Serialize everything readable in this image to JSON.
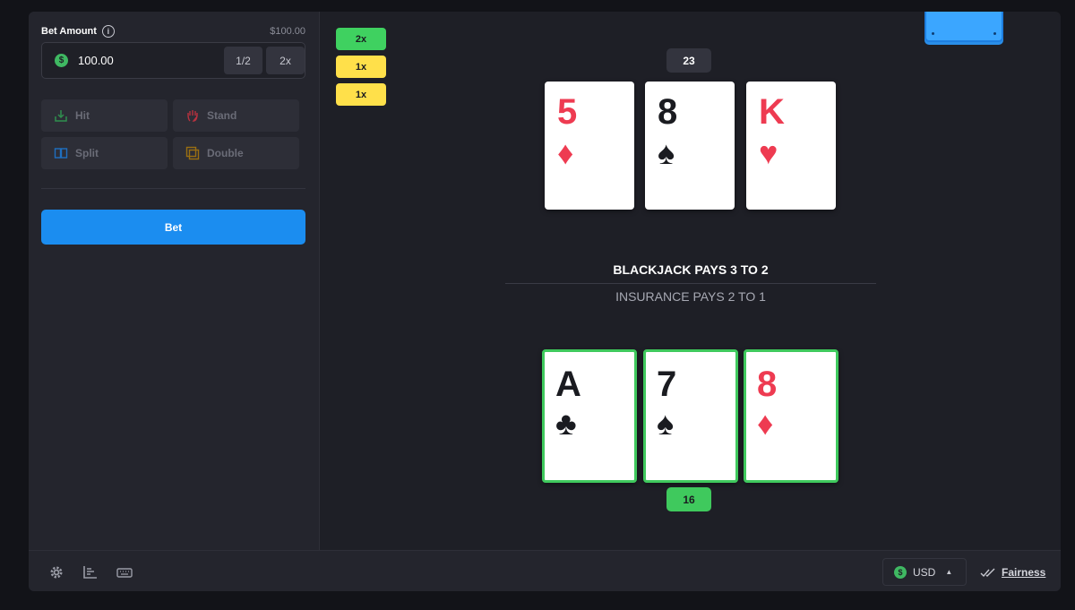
{
  "sidebar": {
    "bet_amount_label": "Bet Amount",
    "balance": "$100.00",
    "amount_value": "100.00",
    "half_label": "1/2",
    "double_amount_label": "2x",
    "actions": {
      "hit": "Hit",
      "stand": "Stand",
      "split": "Split",
      "double": "Double"
    },
    "bet_button": "Bet"
  },
  "table": {
    "multipliers": [
      "2x",
      "1x",
      "1x"
    ],
    "dealer": {
      "score": "23",
      "cards": [
        {
          "rank": "5",
          "suit": "♦",
          "color": "#ee3b51"
        },
        {
          "rank": "8",
          "suit": "♠",
          "color": "#1a1b20"
        },
        {
          "rank": "K",
          "suit": "♥",
          "color": "#ee3b51"
        }
      ]
    },
    "player": {
      "score": "16",
      "cards": [
        {
          "rank": "A",
          "suit": "♣",
          "color": "#1a1b20"
        },
        {
          "rank": "7",
          "suit": "♠",
          "color": "#1a1b20"
        },
        {
          "rank": "8",
          "suit": "♦",
          "color": "#ee3b51"
        }
      ]
    },
    "blackjack_pays": "BLACKJACK PAYS 3 TO 2",
    "insurance_pays": "INSURANCE PAYS 2 TO 1"
  },
  "footer": {
    "currency": "USD",
    "fairness": "Fairness",
    "icons": [
      "gear-icon",
      "stats-icon",
      "keyboard-icon"
    ]
  },
  "colors": {
    "accent_blue": "#1b8df0",
    "win_green": "#3fc95d",
    "multiplier_yellow": "#ffe04a",
    "card_red": "#ee3b51"
  }
}
